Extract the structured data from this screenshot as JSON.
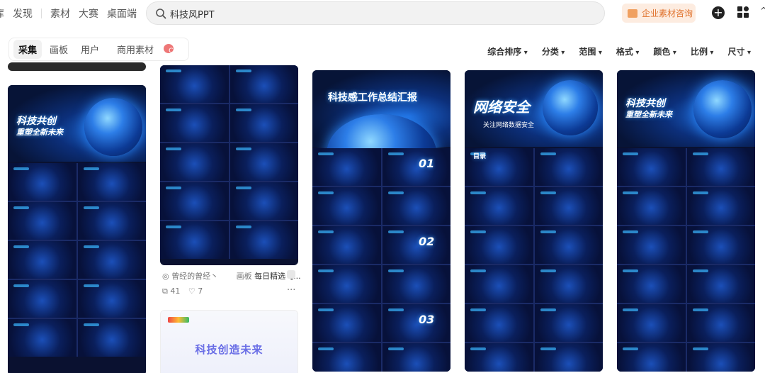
{
  "nav": {
    "items": [
      "库",
      "发现",
      "素材",
      "大赛",
      "桌面端"
    ]
  },
  "search": {
    "value": "科技风PPT"
  },
  "enterprise_label": "企业素材咨询",
  "tabs": [
    {
      "label": "采集",
      "active": true
    },
    {
      "label": "画板"
    },
    {
      "label": "用户"
    },
    {
      "label": "商用素材",
      "badge": "C"
    }
  ],
  "filters": [
    "综合排序",
    "分类",
    "范围",
    "格式",
    "颜色",
    "比例",
    "尺寸"
  ],
  "cards": {
    "col1": {
      "title": "科技共创",
      "subtitle": "重塑全新未来"
    },
    "col3": {
      "title": "科技感工作总结汇报",
      "slides": [
        "01",
        "02",
        "03"
      ]
    },
    "col4": {
      "title": "网络安全",
      "subtitle": "关注网络数据安全",
      "toc": "目录"
    },
    "col5": {
      "title": "科技共创",
      "subtitle": "重塑全新未来"
    },
    "light": {
      "title": "科技创造未来"
    }
  },
  "pin": {
    "author": "曾经的曾经丶",
    "board_prefix": "画板",
    "board": "每日精选【...",
    "saves": "41",
    "likes": "7"
  },
  "colors": {
    "accent": "#e0712b",
    "poster_dark": "#071437",
    "glow": "#2b8cff"
  }
}
